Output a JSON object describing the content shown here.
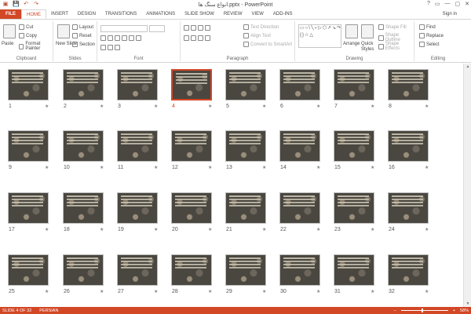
{
  "window": {
    "title": "انواع سنگ ها.pptx - PowerPoint",
    "controls": [
      "?",
      "▭",
      "—",
      "▢",
      "✕"
    ]
  },
  "qat": {
    "save": "💾",
    "undo": "↶",
    "redo": "↷",
    "start": "▣"
  },
  "tabs": [
    "FILE",
    "HOME",
    "INSERT",
    "DESIGN",
    "TRANSITIONS",
    "ANIMATIONS",
    "SLIDE SHOW",
    "REVIEW",
    "VIEW",
    "ADD-INS"
  ],
  "active_tab": "HOME",
  "signin": "Sign in",
  "ribbon": {
    "clipboard": {
      "label": "Clipboard",
      "paste": "Paste",
      "cut": "Cut",
      "copy": "Copy",
      "format_painter": "Format Painter"
    },
    "slides": {
      "label": "Slides",
      "new_slide": "New Slide",
      "layout": "Layout",
      "reset": "Reset",
      "section": "Section"
    },
    "font": {
      "label": "Font"
    },
    "paragraph": {
      "label": "Paragraph",
      "text_direction": "Text Direction",
      "align_text": "Align Text",
      "convert": "Convert to SmartArt"
    },
    "drawing": {
      "label": "Drawing",
      "arrange": "Arrange",
      "quick_styles": "Quick Styles",
      "shape_fill": "Shape Fill",
      "shape_outline": "Shape Outline",
      "shape_effects": "Shape Effects",
      "shapes_glyphs": "▭○\\╲⌐▷⬡↗↘↷☐◇⌒⊂⊃⟨⟩{}☆△"
    },
    "editing": {
      "label": "Editing",
      "find": "Find",
      "replace": "Replace",
      "select": "Select"
    }
  },
  "slides": [
    {
      "n": "1"
    },
    {
      "n": "2"
    },
    {
      "n": "3"
    },
    {
      "n": "4"
    },
    {
      "n": "5"
    },
    {
      "n": "6"
    },
    {
      "n": "7"
    },
    {
      "n": "8"
    },
    {
      "n": "9"
    },
    {
      "n": "10"
    },
    {
      "n": "11"
    },
    {
      "n": "12"
    },
    {
      "n": "13"
    },
    {
      "n": "14"
    },
    {
      "n": "15"
    },
    {
      "n": "16"
    },
    {
      "n": "17"
    },
    {
      "n": "18"
    },
    {
      "n": "19"
    },
    {
      "n": "20"
    },
    {
      "n": "21"
    },
    {
      "n": "22"
    },
    {
      "n": "23"
    },
    {
      "n": "24"
    },
    {
      "n": "25"
    },
    {
      "n": "26"
    },
    {
      "n": "27"
    },
    {
      "n": "28"
    },
    {
      "n": "29"
    },
    {
      "n": "30"
    },
    {
      "n": "31"
    },
    {
      "n": "32"
    }
  ],
  "selected_slide": "4",
  "star": "★",
  "status": {
    "slide": "SLIDE 4 OF 32",
    "language": "PERSIAN",
    "zoom": "58%"
  },
  "colors": {
    "accent": "#d24726"
  }
}
